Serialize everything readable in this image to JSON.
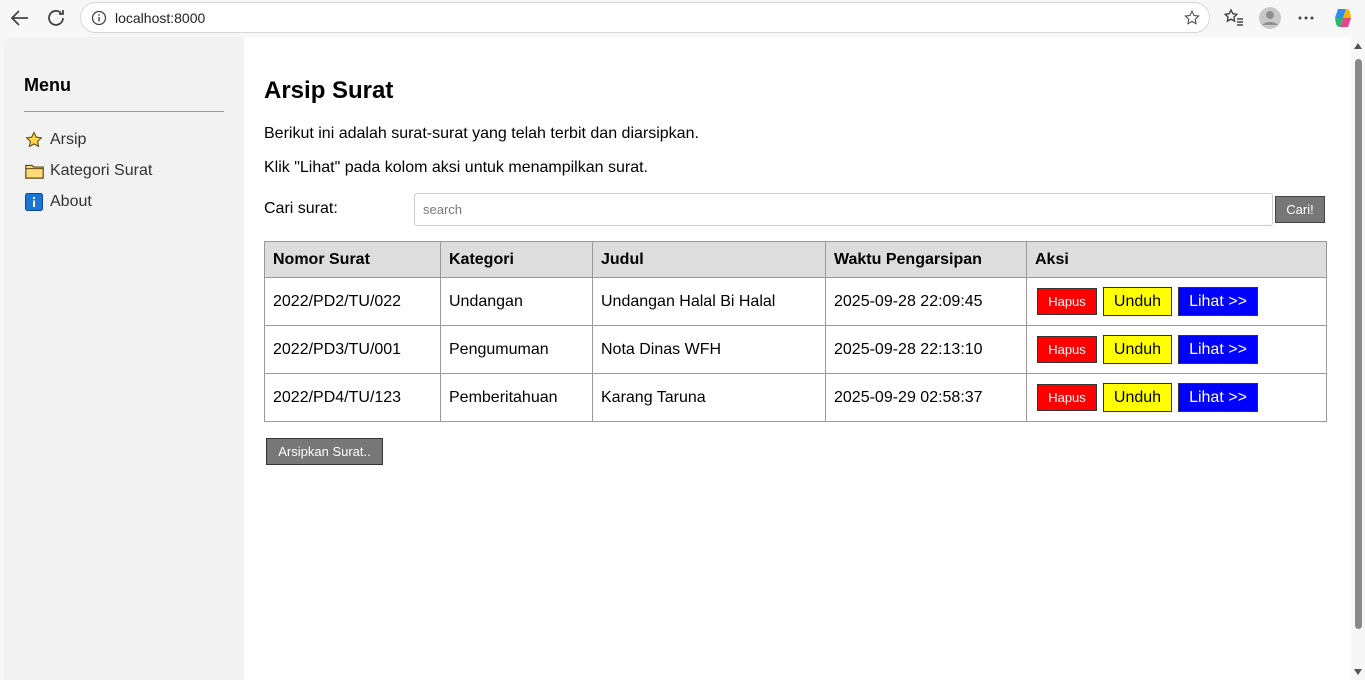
{
  "browser": {
    "url": "localhost:8000"
  },
  "sidebar": {
    "title": "Menu",
    "items": [
      {
        "label": "Arsip",
        "icon": "star-icon"
      },
      {
        "label": "Kategori Surat",
        "icon": "folder-icon"
      },
      {
        "label": "About",
        "icon": "info-icon"
      }
    ]
  },
  "main": {
    "title": "Arsip Surat",
    "description1": "Berikut ini adalah surat-surat yang telah terbit dan diarsipkan.",
    "description2": "Klik \"Lihat\" pada kolom aksi untuk menampilkan surat.",
    "search": {
      "label": "Cari surat:",
      "placeholder": "search",
      "button": "Cari!"
    },
    "table": {
      "headers": [
        "Nomor Surat",
        "Kategori",
        "Judul",
        "Waktu Pengarsipan",
        "Aksi"
      ],
      "rows": [
        {
          "nomor": "2022/PD2/TU/022",
          "kategori": "Undangan",
          "judul": "Undangan Halal Bi Halal",
          "waktu": "2025-09-28 22:09:45"
        },
        {
          "nomor": "2022/PD3/TU/001",
          "kategori": "Pengumuman",
          "judul": "Nota Dinas WFH",
          "waktu": "2025-09-28 22:13:10"
        },
        {
          "nomor": "2022/PD4/TU/123",
          "kategori": "Pemberitahuan",
          "judul": "Karang Taruna",
          "waktu": "2025-09-29 02:58:37"
        }
      ],
      "actions": {
        "hapus": "Hapus",
        "unduh": "Unduh",
        "lihat": "Lihat >>"
      }
    },
    "archive_button": "Arsipkan Surat.."
  },
  "colors": {
    "hapus": "#ff0000",
    "unduh": "#ffff00",
    "lihat": "#0000ff",
    "button_gray": "#777777"
  }
}
